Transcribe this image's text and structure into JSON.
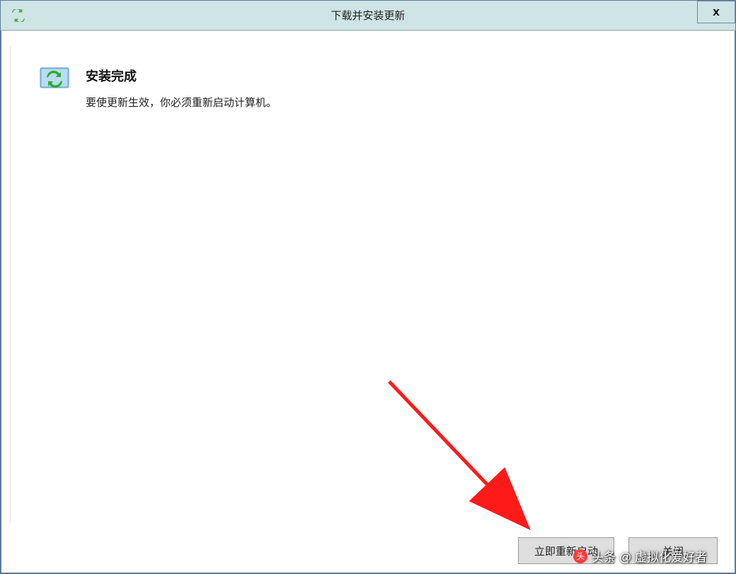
{
  "window": {
    "title": "下载并安装更新",
    "close_label": "x"
  },
  "main": {
    "heading": "安装完成",
    "message": "要使更新生效，你必须重新启动计算机。"
  },
  "footer": {
    "restart_label": "立即重新启动",
    "close_label": "关闭"
  },
  "watermark": {
    "text": "头条 @ 虚拟化爱好者"
  }
}
